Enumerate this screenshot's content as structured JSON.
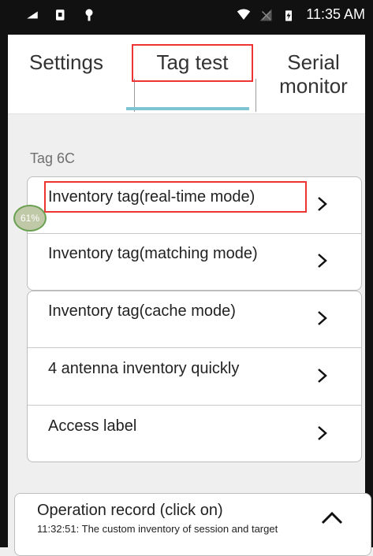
{
  "status_bar": {
    "time": "11:35 AM",
    "icons": [
      "usb-debug-icon",
      "sim-icon",
      "android-icon",
      "wifi-icon",
      "no-signal-icon",
      "battery-charging-icon"
    ]
  },
  "tabs": [
    {
      "label": "Settings"
    },
    {
      "label": "Tag test"
    },
    {
      "label": "Serial\nmonitor"
    }
  ],
  "section_label": "Tag 6C",
  "items": [
    {
      "label": "Inventory tag(real-time mode)"
    },
    {
      "label": "Inventory tag(matching mode)"
    },
    {
      "label": "Inventory tag(cache mode)"
    },
    {
      "label": "4 antenna inventory quickly"
    },
    {
      "label": "Access label"
    }
  ],
  "badge": {
    "text": "61%"
  },
  "operation_record": {
    "title": "Operation record (click on)",
    "log": "11:32:51: The custom inventory of session and target"
  },
  "colors": {
    "tab_indicator": "#7ec4d3",
    "annotation_border": "#ee3333",
    "badge_fill": "#bfc8a7",
    "badge_border": "#6aa051"
  }
}
